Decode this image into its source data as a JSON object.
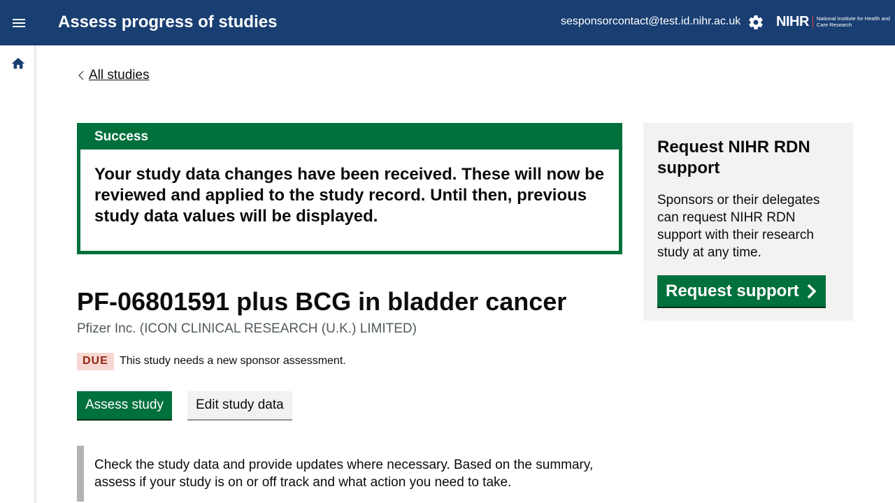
{
  "header": {
    "title": "Assess progress of studies",
    "user_email": "sesponsorcontact@test.id.nihr.ac.uk",
    "logo_main": "NIHR",
    "logo_sub": "National Institute for Health and Care Research",
    "menu_icon": "hamburger-menu-icon",
    "settings_icon": "gear-icon",
    "bg_color": "#193e72"
  },
  "sidebar": {
    "home_icon": "home-icon"
  },
  "breadcrumb": {
    "back_label": "All studies"
  },
  "success": {
    "heading": "Success",
    "message": "Your study data changes have been received. These will now be reviewed and applied to the study record. Until then, previous study data values will be displayed.",
    "color": "#00703c"
  },
  "study": {
    "title": "PF-06801591 plus BCG in bladder cancer",
    "sponsor": "Pfizer Inc. (ICON CLINICAL RESEARCH (U.K.) LIMITED)",
    "status_badge": "DUE",
    "status_text": "This study needs a new sponsor assessment.",
    "assess_button": "Assess study",
    "edit_button": "Edit study data",
    "inset_text": "Check the study data and provide updates where necessary. Based on the summary, assess if your study is on or off track and what action you need to take."
  },
  "aside": {
    "heading": "Request NIHR RDN support",
    "body": "Sponsors or their delegates can request NIHR RDN support with their research study at any time.",
    "button": "Request support"
  }
}
